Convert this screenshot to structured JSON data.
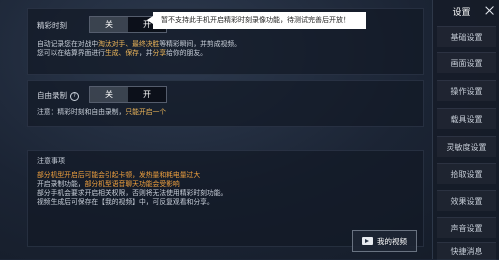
{
  "tooltip": "暂不支持此手机开启精彩时刻录像功能，待测试完善后开放！",
  "highlight_moment": {
    "label": "精彩时刻",
    "toggle_off": "关",
    "toggle_on": "开",
    "desc_line1_a": "自动记录您在对战中",
    "desc_line1_b": "淘汰对手、最终决胜",
    "desc_line1_c": "等精彩瞬间，并剪成视频。",
    "desc_line2_a": "您可以在结算界面进行",
    "desc_line2_b": "生成、保存",
    "desc_line2_c": "，并",
    "desc_line2_d": "分享",
    "desc_line2_e": "给你的朋友。"
  },
  "free_record": {
    "label": "自由录制",
    "help_icon": "?",
    "toggle_off": "关",
    "toggle_on": "开",
    "note_a": "注意：精彩时刻和自由录制，",
    "note_b": "只能开启一个"
  },
  "notes": {
    "title": "注意事项",
    "line1": "部分机型开启后可能会引起卡顿，发热量和耗电量过大",
    "line2_a": "开启录制功能，",
    "line2_b": "部分机型语音聊天功能会受影响",
    "line3": "部分手机会要求开启相关权限，否则将无法使用精彩时刻功能。",
    "line4": "视频生成后可保存在【我的视频】中，可反复观看和分享。"
  },
  "video_button": {
    "label": "我的视频"
  },
  "sidebar": {
    "title": "设置",
    "items": [
      "基础设置",
      "画面设置",
      "操作设置",
      "载具设置",
      "灵敏度设置",
      "拾取设置",
      "效果设置",
      "声音设置",
      "快捷消息"
    ]
  },
  "colors": {
    "highlight": "#f0b85a",
    "background": "#1c2535"
  }
}
